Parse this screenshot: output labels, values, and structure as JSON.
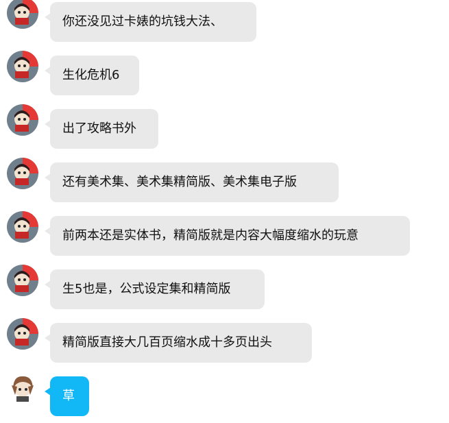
{
  "messages": [
    {
      "text": "你还没见过卡婊的坑钱大法、",
      "sender": "other"
    },
    {
      "text": "生化危机6",
      "sender": "other"
    },
    {
      "text": "出了攻略书外",
      "sender": "other"
    },
    {
      "text": "还有美术集、美术集精简版、美术集电子版",
      "sender": "other"
    },
    {
      "text": "前两本还是实体书，精简版就是内容大幅度缩水的玩意",
      "sender": "other"
    },
    {
      "text": "生5也是，公式设定集和精简版",
      "sender": "other"
    },
    {
      "text": "精简版直接大几百页缩水成十多页出头",
      "sender": "other"
    },
    {
      "text": "草",
      "sender": "self"
    }
  ],
  "colors": {
    "bubble_gray": "#e9e9e9",
    "bubble_blue": "#12b7f5",
    "avatar_red": "#e53935"
  }
}
